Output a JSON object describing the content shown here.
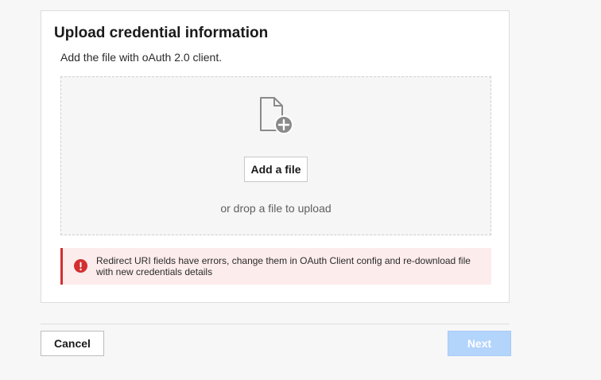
{
  "card": {
    "title": "Upload credential information",
    "subtitle": "Add the file with oAuth 2.0 client."
  },
  "dropzone": {
    "icon": "file-add-icon",
    "add_button_label": "Add a file",
    "drop_text": "or drop a file to upload"
  },
  "error": {
    "icon": "error-icon",
    "message": "Redirect URI fields have errors, change them in OAuth Client config and re-download file with new credentials details",
    "accent_color": "#d32f2f",
    "background_color": "#fdecec"
  },
  "footer": {
    "cancel_label": "Cancel",
    "next_label": "Next",
    "next_disabled": true
  },
  "colors": {
    "primary_disabled": "#b3d4fb"
  }
}
